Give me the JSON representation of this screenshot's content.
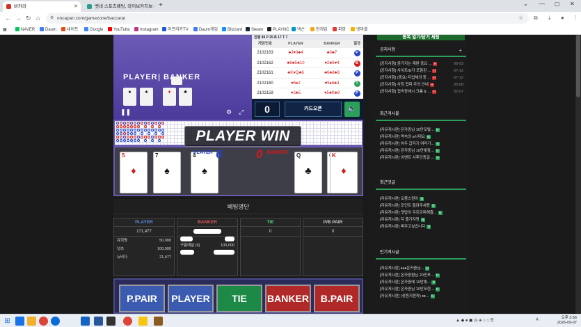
{
  "browser": {
    "tabs": [
      {
        "title": "바카라",
        "active": true,
        "favicon_color": "#d62d20"
      },
      {
        "title": "벳네 스포츠배팅, 라이브카지노 ·",
        "active": false,
        "favicon_color": "#2a9d8f"
      }
    ],
    "new_tab": "+",
    "window_controls": [
      "⌄",
      "—",
      "▢",
      "✕"
    ],
    "url": "oncapan.com/gamezone/baccarat",
    "bookmarks": [
      {
        "label": "NAVER",
        "color": "#03c75a"
      },
      {
        "label": "Daum",
        "color": "#3f7df6"
      },
      {
        "label": "네이트",
        "color": "#e64a19"
      },
      {
        "label": "Google",
        "color": "#4285f4"
      },
      {
        "label": "YouTube",
        "color": "#ff0000"
      },
      {
        "label": "Instagram",
        "color": "#c13584"
      },
      {
        "label": "아프리카TV",
        "color": "#1e5bd8"
      },
      {
        "label": "Daum게임",
        "color": "#3f7df6"
      },
      {
        "label": "Blizzard",
        "color": "#148eff"
      },
      {
        "label": "Steam",
        "color": "#1b2838"
      },
      {
        "label": "PLAYNC",
        "color": "#222222"
      },
      {
        "label": "넥슨",
        "color": "#0099cc"
      },
      {
        "label": "한게임",
        "color": "#f5a623"
      },
      {
        "label": "피망",
        "color": "#e53935"
      },
      {
        "label": "넷마블",
        "color": "#f4b400"
      }
    ]
  },
  "game": {
    "video": {
      "player_sign": "PLAYER",
      "banker_sign": "BANKER",
      "separator": "|",
      "controls": [
        "❚❚",
        "⚙",
        "⤢"
      ]
    },
    "history": {
      "topline": "진행 49  P 25  B 17  T 7",
      "headers": [
        "게임번호",
        "PLAYER",
        "BANKER",
        "결과"
      ],
      "rows": [
        {
          "id": "2102163",
          "player": "♣J♥3♣4",
          "banker": "♣3♣7",
          "result": "P",
          "rcolor": "#2444c8"
        },
        {
          "id": "2102162",
          "player": "♣6♣5♣10",
          "banker": "♥2♣9♥4",
          "result": "B",
          "rcolor": "#d41a1a"
        },
        {
          "id": "2102161",
          "player": "♣K♥Q♣6",
          "banker": "♣6♣8♣9",
          "result": "P",
          "rcolor": "#2444c8"
        },
        {
          "id": "2102160",
          "player": "♥5♠2",
          "banker": "♥5♠6♣3",
          "result": "T",
          "rcolor": "#2aa05a"
        },
        {
          "id": "2102159",
          "player": "♥2♣5",
          "banker": "♥5♣K♣9",
          "result": "P",
          "rcolor": "#2444c8"
        }
      ]
    },
    "count": "0",
    "card_open_label": "카드오픈",
    "sound_icon": "🔈",
    "win_text": "PLAYER WIN",
    "player_label": "PLAYER",
    "player_score": "6",
    "banker_label": "BANKER",
    "banker_score": "0",
    "player_cards": [
      {
        "rank": "5",
        "suit": "♦",
        "color": "red"
      },
      {
        "rank": "7",
        "suit": "♠",
        "color": "blk"
      },
      {
        "rank": "4",
        "suit": "♠",
        "color": "blk"
      }
    ],
    "banker_cards": [
      {
        "rank": "Q",
        "suit": "♣",
        "color": "blk"
      },
      {
        "rank": "Q",
        "suit": "♣",
        "color": "blk"
      },
      {
        "rank": "K",
        "suit": "♦",
        "color": "red"
      }
    ],
    "betting": {
      "title": "베팅명단",
      "columns": [
        {
          "header": "PLAYER",
          "color": "#5b8fe0",
          "total": "171,477"
        },
        {
          "header": "BANKER",
          "color": "#e05b5b",
          "total": ""
        },
        {
          "header": "TIE",
          "color": "#5bcf7a",
          "total": "0"
        },
        {
          "header": "P/B PAIR",
          "color": "#cccccc",
          "total": "0"
        }
      ],
      "player_bets": [
        {
          "name": "유희왕",
          "amount": "50,000"
        },
        {
          "name": "넛츠",
          "amount": "100,000"
        },
        {
          "name": "뉴비다",
          "amount": "21,477"
        }
      ],
      "banker_bets": [
        {
          "name": "",
          "amount": ""
        },
        {
          "name": "구름에달 (6)",
          "amount": "100,000"
        },
        {
          "name": "",
          "amount": ""
        }
      ]
    },
    "bet_buttons": [
      {
        "label": "P.PAIR",
        "color": "#3a5bb0"
      },
      {
        "label": "PLAYER",
        "color": "#3a5bb0"
      },
      {
        "label": "TIE",
        "color": "#1c8a46"
      },
      {
        "label": "BANKER",
        "color": "#b02828"
      },
      {
        "label": "B.PAIR",
        "color": "#b02828"
      }
    ]
  },
  "sidebar": {
    "top_button": "종목 열기/닫기 세팅",
    "notices": {
      "title": "공지사항",
      "plus": "+",
      "items": [
        {
          "text": "[공지사항] 음가지는 재판 중요 ...",
          "date": "05-03"
        },
        {
          "text": "[공지사항] 사이트ID가 포함된 ...",
          "date": "07-12"
        },
        {
          "text": "[공지사항] (중요) 티업체의 등 ...",
          "date": "07-12"
        },
        {
          "text": "[공지사항] 사칭 접대 주의 안내",
          "date": "05-08"
        },
        {
          "text": "[공지사항] 접속장애시 크롬 & ...",
          "date": "02-07"
        }
      ]
    },
    "recent_posts": {
      "title": "최근게시물",
      "items": [
        "[자유게시판] 온카중님 10만포털...",
        "[자유게시판] 먹속의 a시대요",
        "[자유게시판] 어두 갑자기 여러가...",
        "[자유게시판] 온카중님 10만빛깜...",
        "[자유게시판] 이벤트 사후인증글 ..."
      ]
    },
    "recent_comments": {
      "title": "최근댓글",
      "items": [
        "[자유게시판] 오줌스원이",
        "[자유게시판] 포인트 돌려주세용",
        "[자유게시판] 댓밥이 우르르피해줄...",
        "[자유게시판] 자 즐기자멍",
        "[자유게시판] 짜주고싶습니다"
      ]
    },
    "popular": {
      "title": "인기게시글",
      "items": [
        "[자유게시판] ♦♦♦온카중님...",
        "[자유게시판] 온카중형님 20만포...",
        "[자유게시판] 온카중에 10만빛...",
        "[자유게시판] 온카중님 10만포현...",
        "[자유게시판] (성원지원파) ♦♦..."
      ]
    }
  },
  "taskbar": {
    "time": "오후 3:56",
    "date": "2026-09-07",
    "lang": "A"
  }
}
